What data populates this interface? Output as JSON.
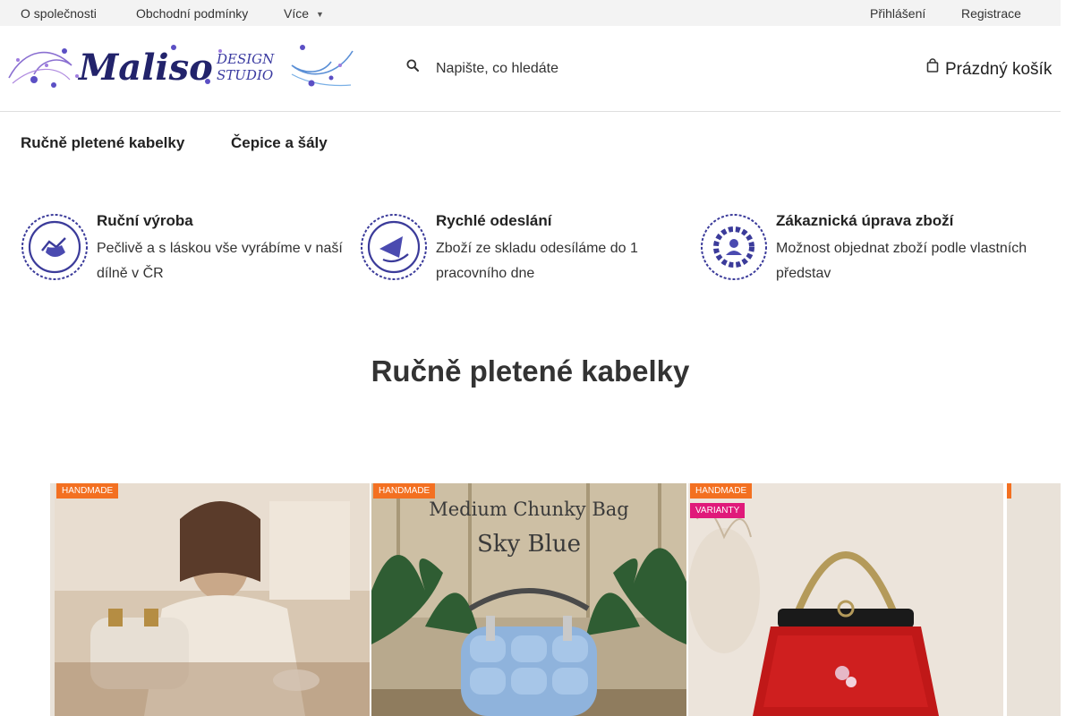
{
  "topbar": {
    "links": [
      "O společnosti",
      "Obchodní podmínky",
      "Více"
    ],
    "more_icon": "chevron-down-icon",
    "account": {
      "login": "Přihlášení",
      "register": "Registrace"
    }
  },
  "header": {
    "logo": {
      "brand": "Maliso",
      "sub_top": "DESIGN",
      "sub_bottom": "STUDIO"
    },
    "search": {
      "placeholder": "Napište, co hledáte",
      "icon": "search-icon"
    },
    "cart": {
      "label": "Prázdný košík",
      "icon": "cart-icon"
    }
  },
  "nav": {
    "items": [
      "Ručně pletené kabelky",
      "Čepice a šály"
    ]
  },
  "features": [
    {
      "title": "Ruční výroba",
      "text": "Pečlivě a s láskou vše vyrábíme v naší dílně v ČR",
      "icon": "handmade-badge-icon"
    },
    {
      "title": "Rychlé odeslání",
      "text": "Zboží ze skladu odesíláme do 1 pracovního dne",
      "icon": "fast-shipping-badge-icon"
    },
    {
      "title": "Zákaznická úprava zboží",
      "text": "Možnost objednat zboží podle vlastních představ",
      "icon": "customization-badge-icon"
    }
  ],
  "section": {
    "title": "Ručně pletené kabelky"
  },
  "products": [
    {
      "tags": [
        "HANDMADE"
      ],
      "overlay": []
    },
    {
      "tags": [
        "HANDMADE"
      ],
      "overlay": [
        "Medium Chunky Bag",
        "Sky Blue"
      ]
    },
    {
      "tags": [
        "HANDMADE",
        "VARIANTY"
      ],
      "overlay": []
    }
  ],
  "colors": {
    "accent_text": "#22236b",
    "tag_handmade": "#f37021",
    "tag_varianty": "#e0197a",
    "badge": "#3b3b9a"
  }
}
